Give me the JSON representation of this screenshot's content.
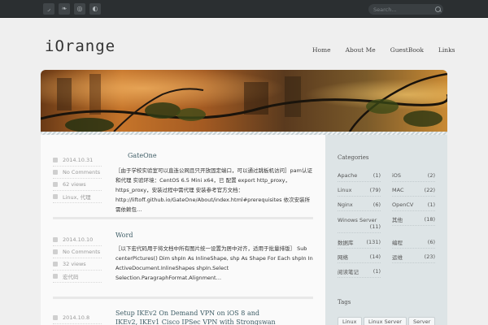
{
  "topbar": {
    "social_icons": [
      {
        "name": "rss-icon",
        "glyph": "◞"
      },
      {
        "name": "twitter-icon",
        "glyph": "❧"
      },
      {
        "name": "weibo-icon",
        "glyph": "◎"
      },
      {
        "name": "qq-icon",
        "glyph": "◐"
      }
    ],
    "search": {
      "placeholder": "Search..."
    }
  },
  "header": {
    "logo": "iOrange",
    "nav": [
      "Home",
      "About Me",
      "GuestBook",
      "Links"
    ]
  },
  "posts": [
    {
      "date": "2014.10.31",
      "comments": "No Comments",
      "views": "62 views",
      "tags": "Linux, 代理",
      "title": "GateOne",
      "excerpt": "［由于学校实验室可以直连公网且只开放固定端口，可以通过跳板机访问］pam认证和代理 实验环境：CentOS 6.5 Mini x64，已 配置 export http_proxy，https_proxy，安装过程中需代理 安装参考官方文档：http://liftoff.github.io/GateOne/About/index.html#prerequisites 依次安装所需依赖包…"
    },
    {
      "date": "2014.10.10",
      "comments": "No Comments",
      "views": "32 views",
      "tags": "宏代码",
      "title": "Word",
      "excerpt": "［以下宏代码用于将文档中所有图片统一设置为居中对齐，适用于批量排版］ Sub centerPictures() Dim shpIn As InlineShape, shp As Shape For Each shpIn In ActiveDocument.InlineShapes shpIn.Select Selection.ParagraphFormat.Alignment…"
    },
    {
      "date": "2014.10.8",
      "title": "Setup IKEv2 On Demand VPN on iOS 8 and IKEv2, IKEv1 Cisco IPSec VPN with Strongswan"
    }
  ],
  "sidebar": {
    "categories_title": "Categories",
    "categories": [
      {
        "name": "Apache",
        "count": "(1)"
      },
      {
        "name": "iOS",
        "count": "(2)"
      },
      {
        "name": "Linux",
        "count": "(79)"
      },
      {
        "name": "MAC",
        "count": "(22)"
      },
      {
        "name": "Nginx",
        "count": "(6)"
      },
      {
        "name": "OpenCV",
        "count": "(1)"
      },
      {
        "name": "Winows Server",
        "count": "(11)"
      },
      {
        "name": "其他",
        "count": "(18)"
      },
      {
        "name": "数据库",
        "count": "(131)"
      },
      {
        "name": "编程",
        "count": "(6)"
      },
      {
        "name": "网络",
        "count": "(14)"
      },
      {
        "name": "运维",
        "count": "(23)"
      },
      {
        "name": "阅读笔记",
        "count": "(1)"
      }
    ],
    "tags_title": "Tags",
    "tags": [
      "Linux",
      "Linux Server",
      "Server"
    ]
  },
  "colors": {
    "accent": "#3e5d66",
    "topbar": "#2b2f31",
    "sidebar": "#dde4e6"
  }
}
